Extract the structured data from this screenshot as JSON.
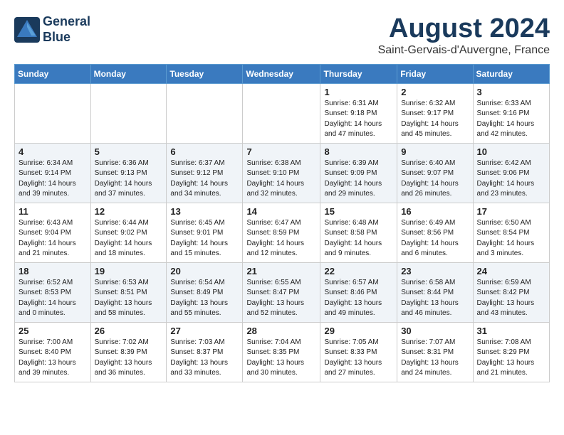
{
  "logo": {
    "line1": "General",
    "line2": "Blue"
  },
  "title": "August 2024",
  "location": "Saint-Gervais-d'Auvergne, France",
  "days_of_week": [
    "Sunday",
    "Monday",
    "Tuesday",
    "Wednesday",
    "Thursday",
    "Friday",
    "Saturday"
  ],
  "weeks": [
    [
      {
        "day": "",
        "info": ""
      },
      {
        "day": "",
        "info": ""
      },
      {
        "day": "",
        "info": ""
      },
      {
        "day": "",
        "info": ""
      },
      {
        "day": "1",
        "info": "Sunrise: 6:31 AM\nSunset: 9:18 PM\nDaylight: 14 hours\nand 47 minutes."
      },
      {
        "day": "2",
        "info": "Sunrise: 6:32 AM\nSunset: 9:17 PM\nDaylight: 14 hours\nand 45 minutes."
      },
      {
        "day": "3",
        "info": "Sunrise: 6:33 AM\nSunset: 9:16 PM\nDaylight: 14 hours\nand 42 minutes."
      }
    ],
    [
      {
        "day": "4",
        "info": "Sunrise: 6:34 AM\nSunset: 9:14 PM\nDaylight: 14 hours\nand 39 minutes."
      },
      {
        "day": "5",
        "info": "Sunrise: 6:36 AM\nSunset: 9:13 PM\nDaylight: 14 hours\nand 37 minutes."
      },
      {
        "day": "6",
        "info": "Sunrise: 6:37 AM\nSunset: 9:12 PM\nDaylight: 14 hours\nand 34 minutes."
      },
      {
        "day": "7",
        "info": "Sunrise: 6:38 AM\nSunset: 9:10 PM\nDaylight: 14 hours\nand 32 minutes."
      },
      {
        "day": "8",
        "info": "Sunrise: 6:39 AM\nSunset: 9:09 PM\nDaylight: 14 hours\nand 29 minutes."
      },
      {
        "day": "9",
        "info": "Sunrise: 6:40 AM\nSunset: 9:07 PM\nDaylight: 14 hours\nand 26 minutes."
      },
      {
        "day": "10",
        "info": "Sunrise: 6:42 AM\nSunset: 9:06 PM\nDaylight: 14 hours\nand 23 minutes."
      }
    ],
    [
      {
        "day": "11",
        "info": "Sunrise: 6:43 AM\nSunset: 9:04 PM\nDaylight: 14 hours\nand 21 minutes."
      },
      {
        "day": "12",
        "info": "Sunrise: 6:44 AM\nSunset: 9:02 PM\nDaylight: 14 hours\nand 18 minutes."
      },
      {
        "day": "13",
        "info": "Sunrise: 6:45 AM\nSunset: 9:01 PM\nDaylight: 14 hours\nand 15 minutes."
      },
      {
        "day": "14",
        "info": "Sunrise: 6:47 AM\nSunset: 8:59 PM\nDaylight: 14 hours\nand 12 minutes."
      },
      {
        "day": "15",
        "info": "Sunrise: 6:48 AM\nSunset: 8:58 PM\nDaylight: 14 hours\nand 9 minutes."
      },
      {
        "day": "16",
        "info": "Sunrise: 6:49 AM\nSunset: 8:56 PM\nDaylight: 14 hours\nand 6 minutes."
      },
      {
        "day": "17",
        "info": "Sunrise: 6:50 AM\nSunset: 8:54 PM\nDaylight: 14 hours\nand 3 minutes."
      }
    ],
    [
      {
        "day": "18",
        "info": "Sunrise: 6:52 AM\nSunset: 8:53 PM\nDaylight: 14 hours\nand 0 minutes."
      },
      {
        "day": "19",
        "info": "Sunrise: 6:53 AM\nSunset: 8:51 PM\nDaylight: 13 hours\nand 58 minutes."
      },
      {
        "day": "20",
        "info": "Sunrise: 6:54 AM\nSunset: 8:49 PM\nDaylight: 13 hours\nand 55 minutes."
      },
      {
        "day": "21",
        "info": "Sunrise: 6:55 AM\nSunset: 8:47 PM\nDaylight: 13 hours\nand 52 minutes."
      },
      {
        "day": "22",
        "info": "Sunrise: 6:57 AM\nSunset: 8:46 PM\nDaylight: 13 hours\nand 49 minutes."
      },
      {
        "day": "23",
        "info": "Sunrise: 6:58 AM\nSunset: 8:44 PM\nDaylight: 13 hours\nand 46 minutes."
      },
      {
        "day": "24",
        "info": "Sunrise: 6:59 AM\nSunset: 8:42 PM\nDaylight: 13 hours\nand 43 minutes."
      }
    ],
    [
      {
        "day": "25",
        "info": "Sunrise: 7:00 AM\nSunset: 8:40 PM\nDaylight: 13 hours\nand 39 minutes."
      },
      {
        "day": "26",
        "info": "Sunrise: 7:02 AM\nSunset: 8:39 PM\nDaylight: 13 hours\nand 36 minutes."
      },
      {
        "day": "27",
        "info": "Sunrise: 7:03 AM\nSunset: 8:37 PM\nDaylight: 13 hours\nand 33 minutes."
      },
      {
        "day": "28",
        "info": "Sunrise: 7:04 AM\nSunset: 8:35 PM\nDaylight: 13 hours\nand 30 minutes."
      },
      {
        "day": "29",
        "info": "Sunrise: 7:05 AM\nSunset: 8:33 PM\nDaylight: 13 hours\nand 27 minutes."
      },
      {
        "day": "30",
        "info": "Sunrise: 7:07 AM\nSunset: 8:31 PM\nDaylight: 13 hours\nand 24 minutes."
      },
      {
        "day": "31",
        "info": "Sunrise: 7:08 AM\nSunset: 8:29 PM\nDaylight: 13 hours\nand 21 minutes."
      }
    ]
  ]
}
